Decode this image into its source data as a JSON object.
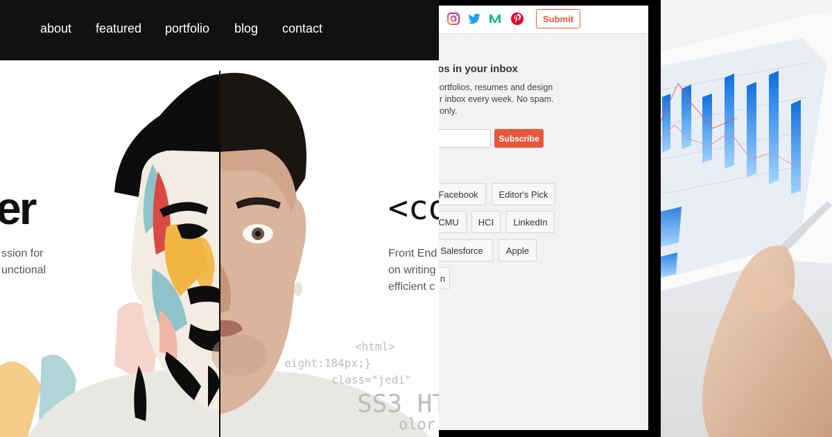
{
  "nav": {
    "items": [
      "about",
      "featured",
      "portfolio",
      "blog",
      "contact"
    ]
  },
  "hero": {
    "headline_left": "er",
    "desc_left": "ssion for\nunctional",
    "headline_right": "<co",
    "desc_right": "Front End\non writing\nefficient c",
    "code_lines": [
      "<html>",
      "eight:184px;}",
      "class=\"jedi\"",
      "SS3 HT",
      "olor"
    ]
  },
  "inbox": {
    "title": "ios in your inbox",
    "text": "portfolios, resumes and design\nur inbox every week. No spam.\nt only.",
    "subscribe_label": "Subscribe",
    "email_placeholder": "",
    "submit_label": "Submit"
  },
  "social_icons": [
    "instagram-icon",
    "twitter-icon",
    "medium-icon",
    "pinterest-icon"
  ],
  "tags": {
    "row1": [
      "Facebook",
      "Editor's Pick"
    ],
    "row2": [
      "CMU",
      "HCI",
      "LinkedIn"
    ],
    "row3": [
      "Salesforce",
      "Apple"
    ],
    "row4": [
      "n"
    ]
  },
  "colors": {
    "accent": "#e8573b",
    "nav_bg": "#111111",
    "panel_bg": "#f2f2f2",
    "chart_blue": "#1f8ef0"
  }
}
